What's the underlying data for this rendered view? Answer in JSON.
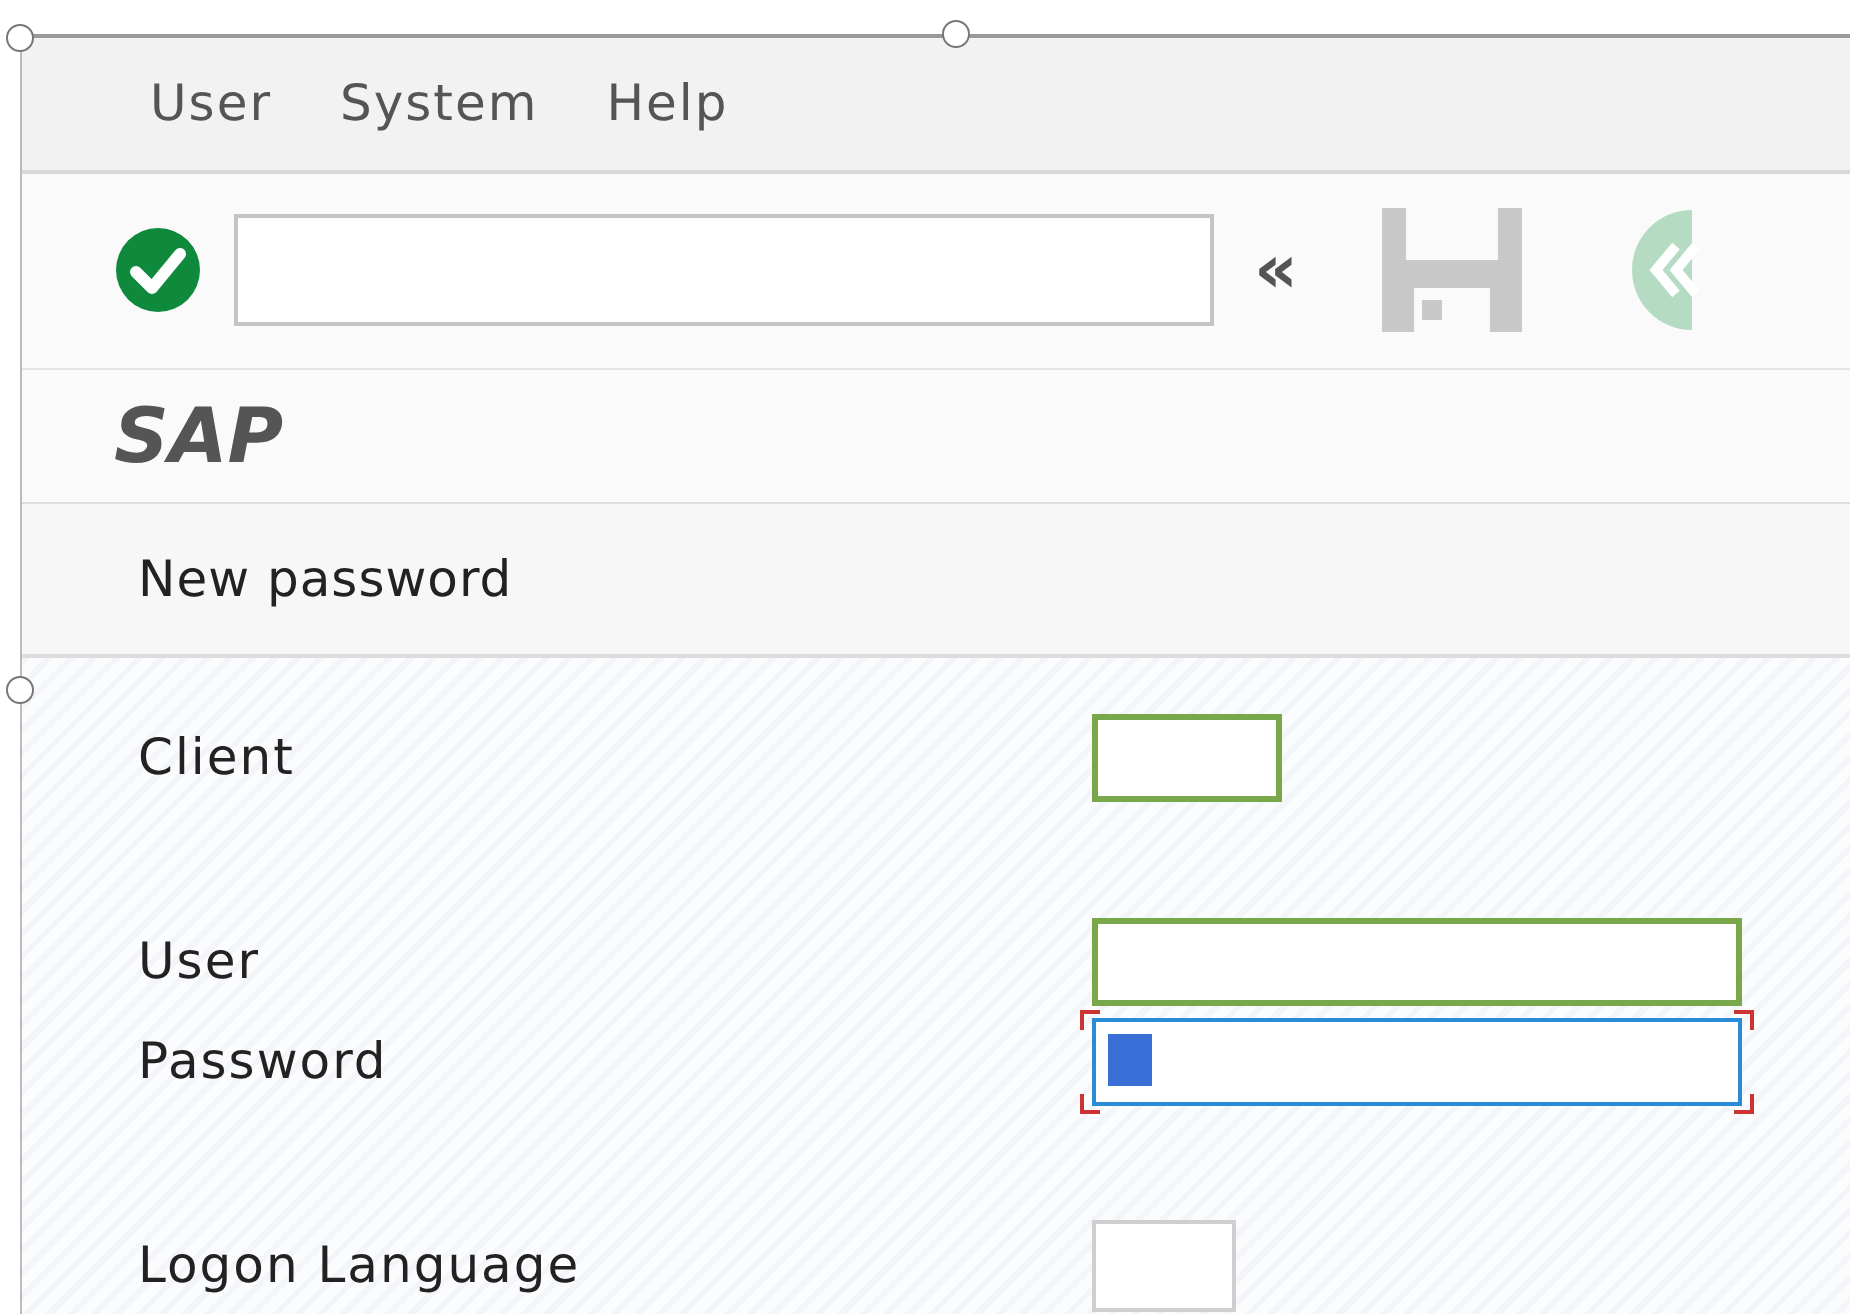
{
  "menu": [
    {
      "label": "User"
    },
    {
      "label": "System"
    },
    {
      "label": "Help"
    }
  ],
  "toolbar": {
    "collapse": "«"
  },
  "app_title": "SAP",
  "screen_title": "New password",
  "field_groups": [
    [
      {
        "label": "Client",
        "kind": "short",
        "required": true,
        "focused": false
      }
    ],
    [
      {
        "label": "User",
        "kind": "long",
        "required": true,
        "focused": false
      },
      {
        "label": "Password",
        "kind": "long",
        "required": false,
        "focused": true
      }
    ],
    [
      {
        "label": "Logon Language",
        "kind": "tiny",
        "required": false,
        "focused": false
      }
    ]
  ]
}
